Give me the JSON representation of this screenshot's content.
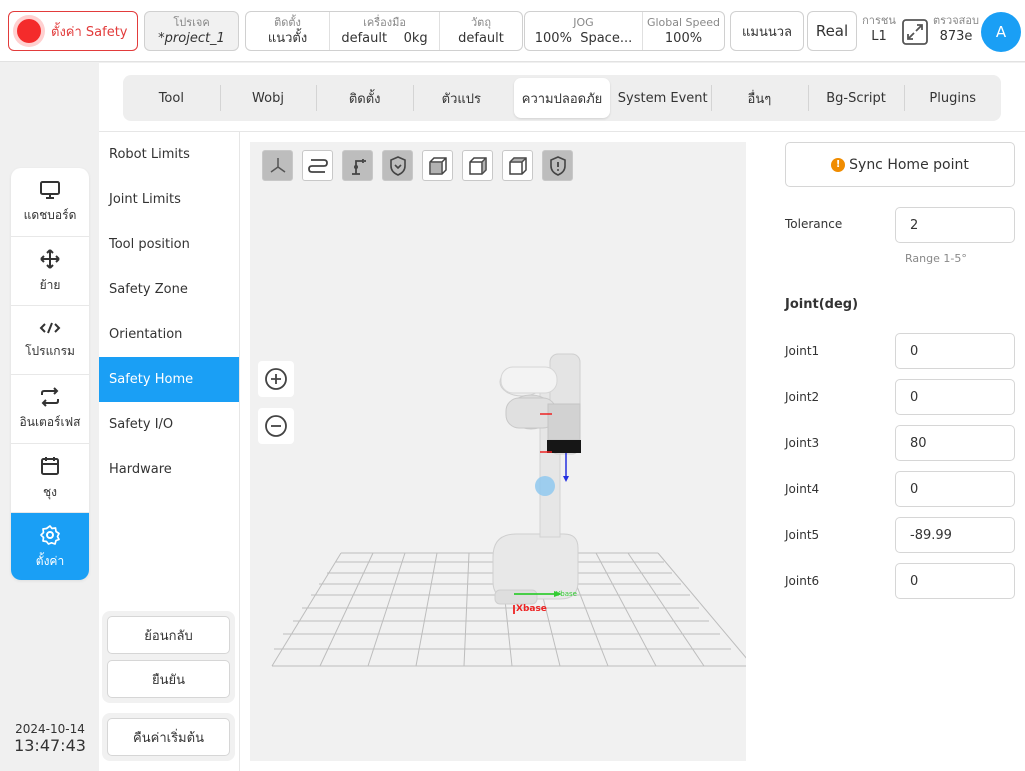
{
  "topbar": {
    "safety_label": "ตั้งค่า Safety",
    "project": {
      "caption": "โปรเจค",
      "value": "*project_1"
    },
    "install": {
      "caption": "ติดตั้ง",
      "value": "แนวตั้ง"
    },
    "tool": {
      "caption": "เครื่องมือ",
      "value": "default",
      "weight": "0kg"
    },
    "object": {
      "caption": "วัตถุ",
      "value": "default"
    },
    "jog": {
      "caption": "JOG",
      "value": "100%",
      "mode": "Space..."
    },
    "global_speed": {
      "caption": "Global Speed",
      "value": "100%"
    },
    "manual_label": "แมนนวล",
    "real_label": "Real",
    "collision": {
      "caption": "การชน",
      "value": "L1"
    },
    "checksum": {
      "caption": "ตรวจสอบ",
      "value": "873e"
    },
    "avatar": "A"
  },
  "leftnav": {
    "items": [
      {
        "label": "แดชบอร์ด",
        "icon": "monitor-icon"
      },
      {
        "label": "ย้าย",
        "icon": "move-icon"
      },
      {
        "label": "โปรแกรม",
        "icon": "code-icon"
      },
      {
        "label": "อินเตอร์เฟส",
        "icon": "interface-icon"
      },
      {
        "label": "ชุง",
        "icon": "calendar-icon"
      },
      {
        "label": "ตั้งค่า",
        "icon": "gear-icon"
      }
    ],
    "active": "ตั้งค่า"
  },
  "datetime": {
    "date": "2024-10-14",
    "time": "13:47:43"
  },
  "tabs": [
    "Tool",
    "Wobj",
    "ติดตั้ง",
    "ตัวแปร",
    "ความปลอดภัย",
    "System Event",
    "อื่นๆ",
    "Bg-Script",
    "Plugins"
  ],
  "active_tab": "ความปลอดภัย",
  "submenu": [
    "Robot Limits",
    "Joint Limits",
    "Tool position",
    "Safety Zone",
    "Orientation",
    "Safety Home",
    "Safety I/O",
    "Hardware"
  ],
  "active_submenu": "Safety Home",
  "buttons": {
    "back": "ย้อนกลับ",
    "confirm": "ยืนยัน",
    "reset": "คืนค่าเริ่มต้น"
  },
  "viewport": {
    "toolbar_icons": [
      "axes-view-icon",
      "path-icon",
      "robot-view-icon",
      "shield-view-icon",
      "front-cube-icon",
      "side-cube-icon",
      "top-cube-icon",
      "safety-shield-icon"
    ],
    "axis_labels": {
      "x": "Xbase",
      "y": "Ybase"
    }
  },
  "safety_home": {
    "sync_label": "Sync Home point",
    "tolerance_label": "Tolerance",
    "tolerance_value": "2",
    "range_hint": "Range 1-5°",
    "joint_title": "Joint(deg)",
    "joints": [
      {
        "label": "Joint1",
        "value": "0"
      },
      {
        "label": "Joint2",
        "value": "0"
      },
      {
        "label": "Joint3",
        "value": "80"
      },
      {
        "label": "Joint4",
        "value": "0"
      },
      {
        "label": "Joint5",
        "value": "-89.99"
      },
      {
        "label": "Joint6",
        "value": "0"
      }
    ]
  },
  "colors": {
    "accent": "#1a9ff5",
    "danger": "#e23b3b",
    "warning": "#f08c00"
  }
}
